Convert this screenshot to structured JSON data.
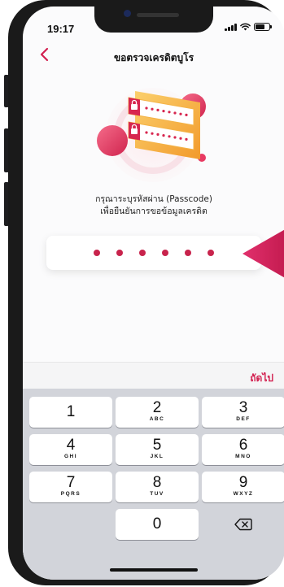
{
  "status_bar": {
    "time": "19:17",
    "battery_level": 0.7
  },
  "header": {
    "title": "ขอตรวจเครดิตบูโร",
    "back_icon": "chevron-left-icon"
  },
  "illustration": {
    "icon": "passcode-lock-card-icon"
  },
  "instructions": {
    "line1": "กรุณาระบุรหัสผ่าน (Passcode)",
    "line2": "เพื่อยืนยันการขอข้อมูลเครดิต"
  },
  "passcode": {
    "length": 6,
    "filled": 6
  },
  "next_button": {
    "label": "ถัดไป"
  },
  "keypad": {
    "keys": [
      {
        "num": "1",
        "letters": ""
      },
      {
        "num": "2",
        "letters": "ABC"
      },
      {
        "num": "3",
        "letters": "DEF"
      },
      {
        "num": "4",
        "letters": "GHI"
      },
      {
        "num": "5",
        "letters": "JKL"
      },
      {
        "num": "6",
        "letters": "MNO"
      },
      {
        "num": "7",
        "letters": "PQRS"
      },
      {
        "num": "8",
        "letters": "TUV"
      },
      {
        "num": "9",
        "letters": "WXYZ"
      },
      {
        "num": "0",
        "letters": ""
      }
    ],
    "delete_icon": "backspace-icon"
  },
  "colors": {
    "accent": "#d21f4f",
    "dot": "#c8234c",
    "keypad_bg": "#d2d4da"
  }
}
